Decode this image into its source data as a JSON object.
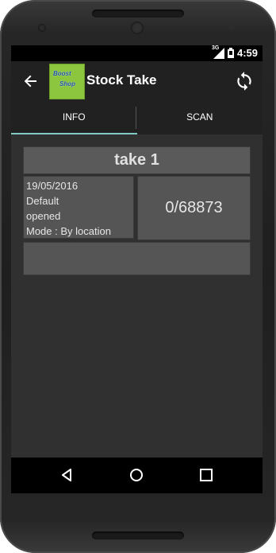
{
  "status": {
    "time": "4:59",
    "network": "3G"
  },
  "appbar": {
    "title": "Stock Take",
    "logo_line1": "Boost",
    "logo_line2": "Shop"
  },
  "tabs": [
    {
      "label": "INFO"
    },
    {
      "label": "SCAN"
    }
  ],
  "take": {
    "name": "take 1",
    "date": "19/05/2016",
    "location": "Default",
    "state": "opened",
    "mode": "Mode : By location",
    "count": "0/68873"
  },
  "colors": {
    "tab_indicator": "#80cbc4",
    "logo_bg": "#8cc63f",
    "appbar": "#212121"
  }
}
